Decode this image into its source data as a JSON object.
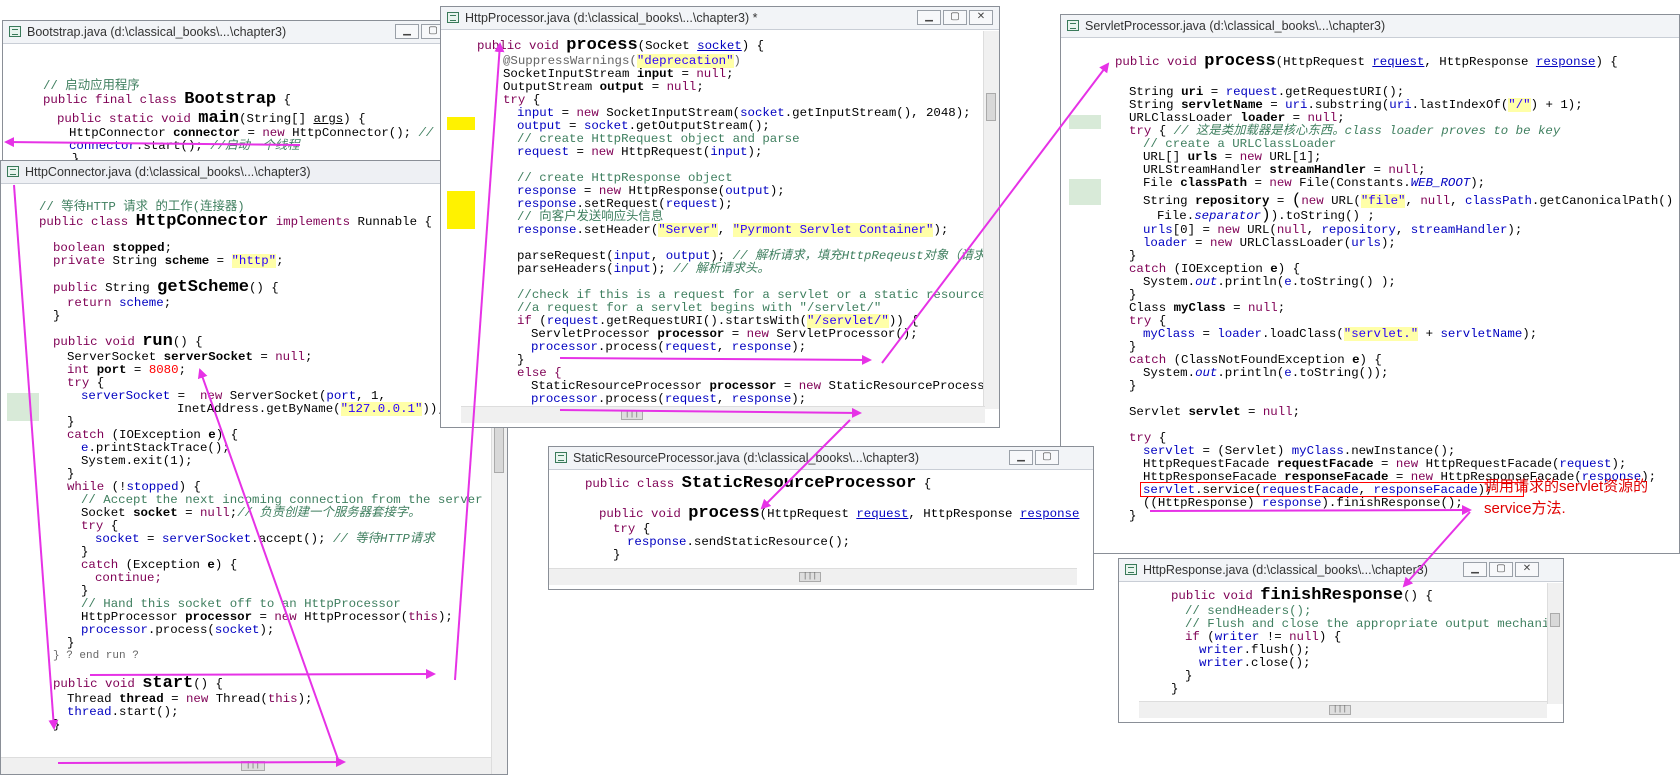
{
  "windows": {
    "bootstrap": {
      "title": "Bootstrap.java (d:\\classical_books\\...\\chapter3)",
      "lines": [
        "// 启动应用程序",
        "public final class Bootstrap {",
        "  public static void main(String[] args) {",
        "    HttpConnector connector = new HttpConnector(); // 连接器",
        "    connector.start(); //启动一个线程",
        "  }"
      ]
    },
    "httpconnector": {
      "title": "HttpConnector.java (d:\\classical_books\\...\\chapter3)",
      "lines": [
        "// 等待HTTP 请求 的工作(连接器)",
        "public class HttpConnector implements Runnable {",
        "boolean stopped;",
        "private String scheme = \"http\";",
        "public String getScheme() {",
        "return scheme;",
        "}",
        "public void run() {",
        "ServerSocket serverSocket = null;",
        "int port = 8080;",
        "try {",
        "serverSocket =  new ServerSocket(port, 1,",
        "InetAddress.getByName(\"127.0.0.1\"));",
        "}",
        "catch (IOException e) {",
        "e.printStackTrace();",
        "System.exit(1);",
        "}",
        "while (!stopped) {",
        "// Accept the next incoming connection from the server socket",
        "Socket socket = null;// 负责创建一个服务器套接字。",
        "try {",
        "socket = serverSocket.accept(); // 等待HTTP请求",
        "}",
        "catch (Exception e) {",
        "continue;",
        "}",
        "// Hand this socket off to an HttpProcessor",
        "HttpProcessor processor = new HttpProcessor(this);",
        "processor.process(socket);",
        "}",
        "} ? end run ?",
        "public void start() {",
        "Thread thread = new Thread(this);",
        "thread.start();",
        "}"
      ]
    },
    "httpprocessor": {
      "title": "HttpProcessor.java (d:\\classical_books\\...\\chapter3) *",
      "lines": [
        "public void process(Socket socket) {",
        "@SuppressWarnings(\"deprecation\")",
        "SocketInputStream input = null;",
        "OutputStream output = null;",
        "try {",
        "input = new SocketInputStream(socket.getInputStream(), 2048);",
        "output = socket.getOutputStream();",
        "// create HttpRequest object and parse",
        "request = new HttpRequest(input);",
        "// create HttpResponse object",
        "response = new HttpResponse(output);",
        "response.setRequest(request);",
        "// 向客户发送响应头信息",
        "response.setHeader(\"Server\", \"Pyrmont Servlet Container\");",
        "parseRequest(input, output); // 解析请求，填充HttpReqeust对象（请求的是静态资源",
        "parseHeaders(input); // 解析请求头。",
        "//check if this is a request for a servlet or a static resource",
        "//a request for a servlet begins with \"/servlet/\"",
        "if (request.getRequestURI().startsWith(\"/servlet/\")) {",
        "ServletProcessor processor = new ServletProcessor();",
        "processor.process(request, response);",
        "}",
        "else {",
        "StaticResourceProcessor processor = new StaticResourceProcessor();",
        "processor.process(request, response);",
        "}"
      ]
    },
    "servletprocessor": {
      "title": "ServletProcessor.java (d:\\classical_books\\...\\chapter3)",
      "lines": [
        "public void process(HttpRequest request, HttpResponse response) {",
        "String uri = request.getRequestURI();",
        "String servletName = uri.substring(uri.lastIndexOf(\"/\") + 1);",
        "URLClassLoader loader = null;",
        "try { // 这是类加载器是核心东西。class loader proves to be key",
        "// create a URLClassLoader",
        "URL[] urls = new URL[1];",
        "URLStreamHandler streamHandler = null;",
        "File classPath = new File(Constants.WEB_ROOT);",
        "String repository = (new URL(\"file\", null, classPath.getCanonicalPath() +",
        "File.separator)).toString() ;",
        "urls[0] = new URL(null, repository, streamHandler);",
        "loader = new URLClassLoader(urls);",
        "}",
        "catch (IOException e) {",
        "System.out.println(e.toString() );",
        "}",
        "Class myClass = null;",
        "try {",
        "myClass = loader.loadClass(\"servlet.\" + servletName);",
        "}",
        "catch (ClassNotFoundException e) {",
        "System.out.println(e.toString());",
        "}",
        "Servlet servlet = null;",
        "try {",
        "servlet = (Servlet) myClass.newInstance();",
        "HttpRequestFacade requestFacade = new HttpRequestFacade(request);",
        "HttpResponseFacade responseFacade = new HttpResponseFacade(response);",
        "servlet.service(requestFacade, responseFacade);",
        "((HttpResponse) response).finishResponse();",
        "}"
      ]
    },
    "staticresource": {
      "title": "StaticResourceProcessor.java (d:\\classical_books\\...\\chapter3)",
      "lines": [
        "public class StaticResourceProcessor {",
        "public void process(HttpRequest request, HttpResponse response",
        "try {",
        "response.sendStaticResource();",
        "}"
      ]
    },
    "httpresponse": {
      "title": "HttpResponse.java (d:\\classical_books\\...\\chapter3)",
      "lines": [
        "public void finishResponse() {",
        "// sendHeaders();",
        "// Flush and close the appropriate output mechanism",
        "if (writer != null) {",
        "writer.flush();",
        "writer.close();",
        "}",
        "}"
      ]
    }
  },
  "annotation": {
    "line1": "调用请求的servlet资源的",
    "line2": "service方法."
  },
  "colors": {
    "arrow": "#e632e6",
    "keyword": "#7f0055",
    "string": "#2a00ff",
    "comment": "#3f7f5f",
    "field": "#0000c0",
    "annotation_red": "#e00000",
    "highlight_yellow": "#fff200"
  }
}
